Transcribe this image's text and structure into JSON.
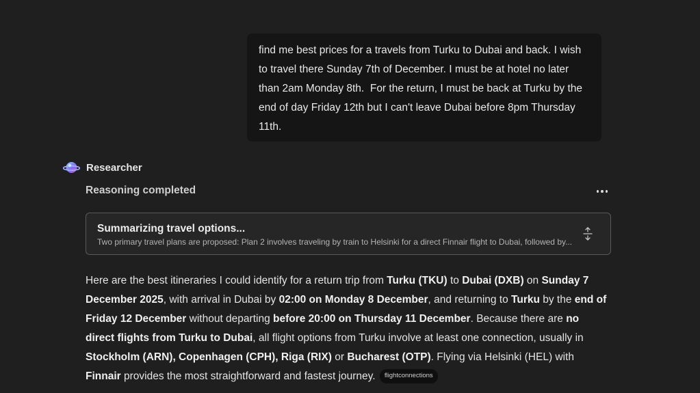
{
  "user_message": "find me best prices for a travels from Turku to Dubai and back. I wish to travel there Sunday 7th of December. I must be at hotel no later than 2am Monday 8th.  For the return, I must be back at Turku by the end of day Friday 12th but I can't leave Dubai before 8pm Thursday 11th.",
  "agent": {
    "name": "Researcher",
    "avatar_icon": "researcher-orb-icon"
  },
  "reasoning": {
    "status": "Reasoning completed",
    "more_icon": "ellipsis-icon",
    "card": {
      "title": "Summarizing travel options...",
      "description": "Two primary travel plans are proposed: Plan 2 involves traveling by train to Helsinki for a direct Finnair flight to Dubai, followed by...",
      "expand_icon": "expand-collapse-icon"
    }
  },
  "response": {
    "segments": [
      {
        "text": "Here are the best itineraries I could identify for a return trip from ",
        "bold": false
      },
      {
        "text": "Turku (TKU)",
        "bold": true
      },
      {
        "text": " to ",
        "bold": false
      },
      {
        "text": "Dubai (DXB)",
        "bold": true
      },
      {
        "text": " on ",
        "bold": false
      },
      {
        "text": "Sunday 7 December 2025",
        "bold": true
      },
      {
        "text": ", with arrival in Dubai by ",
        "bold": false
      },
      {
        "text": "02:00 on Monday 8 December",
        "bold": true
      },
      {
        "text": ", and returning to ",
        "bold": false
      },
      {
        "text": "Turku",
        "bold": true
      },
      {
        "text": " by the ",
        "bold": false
      },
      {
        "text": "end of Friday 12 December",
        "bold": true
      },
      {
        "text": " without departing ",
        "bold": false
      },
      {
        "text": "before 20:00 on Thursday 11 December",
        "bold": true
      },
      {
        "text": ". Because there are ",
        "bold": false
      },
      {
        "text": "no direct flights from Turku to Dubai",
        "bold": true
      },
      {
        "text": ", all flight options from Turku involve at least one connection, usually in ",
        "bold": false
      },
      {
        "text": "Stockholm (ARN), Copenhagen (CPH), Riga (RIX)",
        "bold": true
      },
      {
        "text": " or ",
        "bold": false
      },
      {
        "text": "Bucharest (OTP)",
        "bold": true
      },
      {
        "text": ". Flying via Helsinki (HEL) with ",
        "bold": false
      },
      {
        "text": "Finnair",
        "bold": true
      },
      {
        "text": " provides the most straightforward and fastest journey.",
        "bold": false
      }
    ],
    "citation": "flightconnections"
  },
  "colors": {
    "background": "#1f1f1f",
    "user_bubble": "#151515",
    "card_background": "#262626",
    "card_border": "#5a5a5a",
    "citation_pill": "#0f0f0f"
  }
}
